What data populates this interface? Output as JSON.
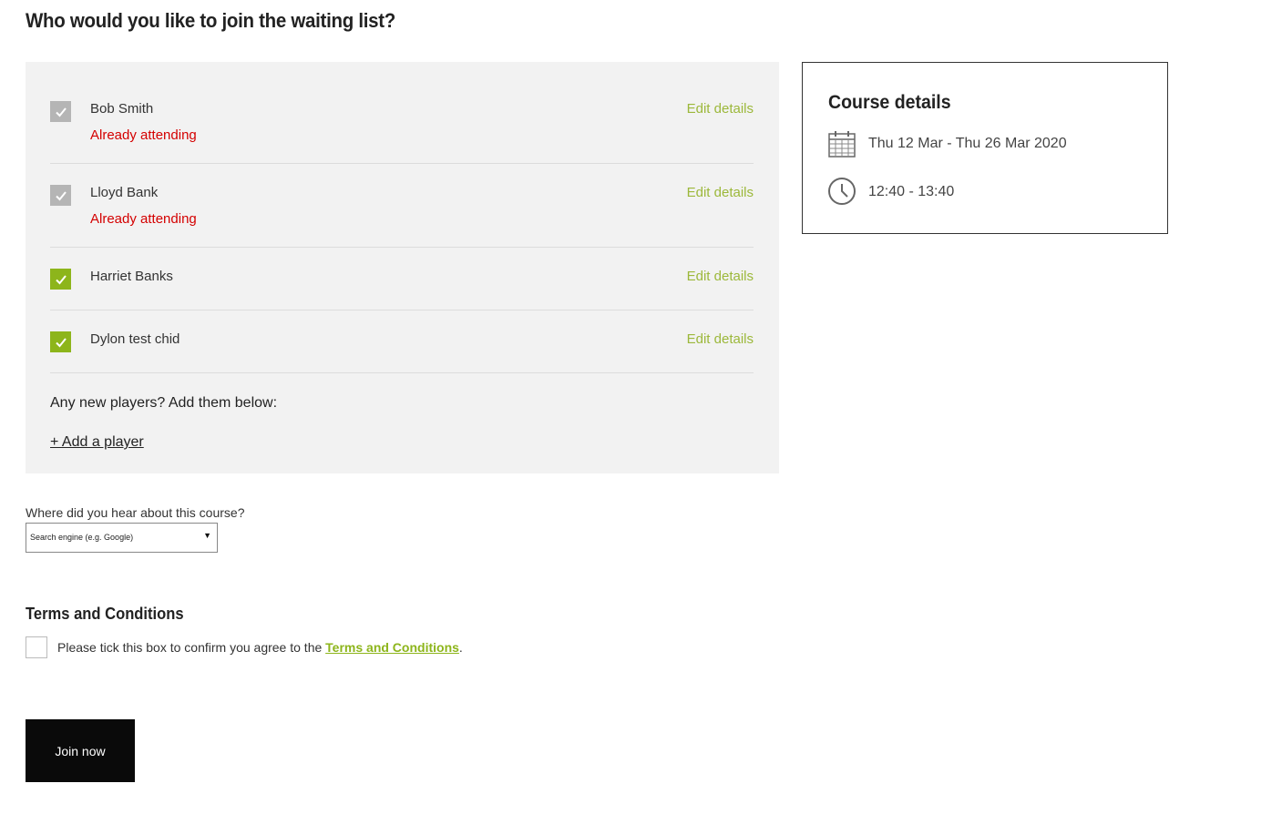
{
  "page": {
    "title": "Who would you like to join the waiting list?"
  },
  "players": [
    {
      "name": "Bob Smith",
      "status": "disabled",
      "note": "Already attending",
      "edit_label": "Edit details"
    },
    {
      "name": "Lloyd Bank",
      "status": "disabled",
      "note": "Already attending",
      "edit_label": "Edit details"
    },
    {
      "name": "Harriet Banks",
      "status": "checked",
      "note": "",
      "edit_label": "Edit details"
    },
    {
      "name": "Dylon test chid",
      "status": "checked",
      "note": "",
      "edit_label": "Edit details"
    }
  ],
  "new_players": {
    "label": "Any new players? Add them below:",
    "add_link": "+ Add a player"
  },
  "course": {
    "title": "Course details",
    "dates": "Thu 12 Mar - Thu 26 Mar 2020",
    "time": "12:40 - 13:40",
    "date_icon": "calendar-icon",
    "time_icon": "clock-icon"
  },
  "referral": {
    "label": "Where did you hear about this course?",
    "selected": "Search engine (e.g. Google)"
  },
  "terms": {
    "heading": "Terms and Conditions",
    "text_before": "Please tick this box to confirm you agree to the ",
    "link": "Terms and Conditions",
    "text_after": "."
  },
  "actions": {
    "join_label": "Join now"
  },
  "colors": {
    "accent": "#8db51b",
    "edit_link": "#9cb83a",
    "warning": "#d40000",
    "panel_bg": "#f2f2f2",
    "disabled_checkbox": "#b5b5b5",
    "button_bg": "#0a0a0a"
  }
}
